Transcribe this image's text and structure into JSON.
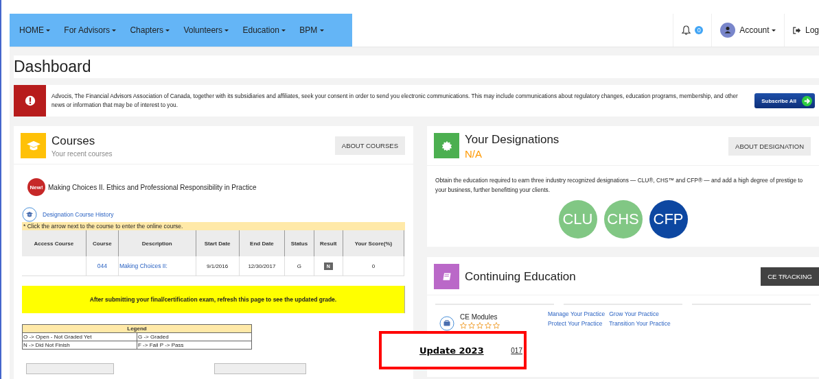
{
  "nav": {
    "items": [
      {
        "label": "HOME"
      },
      {
        "label": "For Advisors"
      },
      {
        "label": "Chapters"
      },
      {
        "label": "Volunteers"
      },
      {
        "label": "Education"
      },
      {
        "label": "BPM"
      }
    ],
    "badge": "0",
    "account": "Account",
    "logout": "Log"
  },
  "title": "Dashboard",
  "alert": {
    "text": "Advocis, The Financial Advisors Association of Canada, together with its subsidiaries and affiliates, seek your consent in order to send you electronic communications. This may include communications about regulatory changes, education programs, membership, and other news or information that may be of interest to you.",
    "button": "Subscribe All"
  },
  "courses": {
    "title": "Courses",
    "subtitle": "Your recent courses",
    "button": "ABOUT COURSES",
    "new_badge": "New!",
    "featured": "Making Choices II. Ethics and Professional Responsibility in Practice",
    "history_link": "Designation Course History",
    "note": "* Click the arrow next to the course to enter the online course.",
    "columns": [
      "Access Course",
      "Course",
      "Description",
      "Start Date",
      "End Date",
      "Status",
      "Result",
      "Your Score(%)"
    ],
    "rows": [
      {
        "access": "",
        "course": "044",
        "description": "Making Choices II:",
        "start": "9/1/2016",
        "end": "12/30/2017",
        "status": "G",
        "result": "N",
        "score": "0"
      }
    ],
    "notice": "After submitting your final/certification exam, refresh this page to see the updated grade.",
    "legend": {
      "title": "Legend",
      "cells": [
        "O -> Open - Not Graded Yet",
        "G -> Graded",
        "N -> Did Not Finish",
        "F -> Fail    P -> Pass"
      ]
    }
  },
  "designations": {
    "title": "Your Designations",
    "status": "N/A",
    "button": "ABOUT DESIGNATION",
    "text": "Obtain the education required to earn three industry recognized designations — CLU®, CHS™ and CFP® — and add a high degree of prestige to your business, further benefitting your clients.",
    "badges": [
      {
        "label": "CLU",
        "color": "#81c784"
      },
      {
        "label": "CHS",
        "color": "#81c784"
      },
      {
        "label": "CFP",
        "color": "#0d47a1"
      }
    ]
  },
  "ce": {
    "title": "Continuing Education",
    "button": "CE TRACKING",
    "module": "CE Modules",
    "stars": 0,
    "links": [
      "Manage Your Practice",
      "Grow Your Practice",
      "Protect Your Practice",
      "Transition Your Practice"
    ],
    "cut_link": "017"
  },
  "callout": "Update 2023"
}
